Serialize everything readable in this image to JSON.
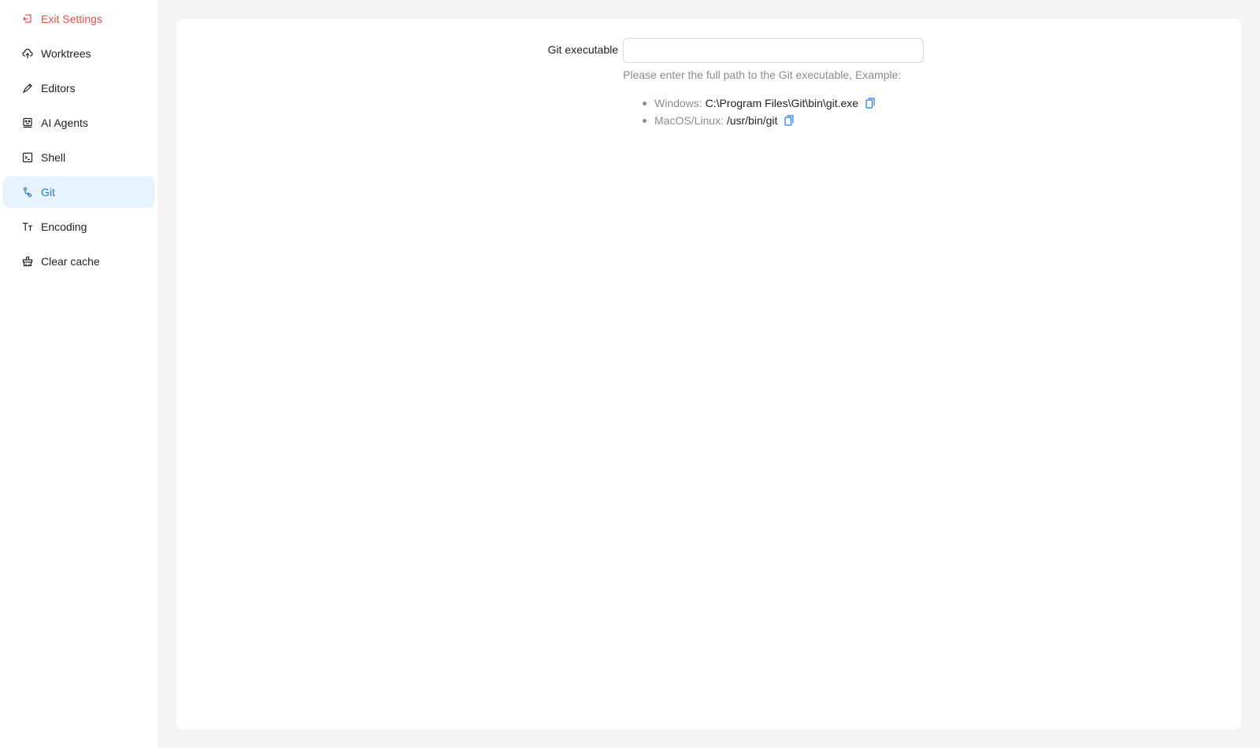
{
  "sidebar": {
    "items": [
      {
        "label": "Exit Settings",
        "icon": "exit-icon"
      },
      {
        "label": "Worktrees",
        "icon": "cloud-upload-icon"
      },
      {
        "label": "Editors",
        "icon": "edit-icon"
      },
      {
        "label": "AI Agents",
        "icon": "robot-icon"
      },
      {
        "label": "Shell",
        "icon": "terminal-icon"
      },
      {
        "label": "Git",
        "icon": "git-branch-icon",
        "active": true
      },
      {
        "label": "Encoding",
        "icon": "font-size-icon"
      },
      {
        "label": "Clear cache",
        "icon": "clear-icon"
      }
    ]
  },
  "git_settings": {
    "label": "Git executable",
    "value": "",
    "help": "Please enter the full path to the Git executable, Example:",
    "examples": [
      {
        "os": "Windows:",
        "path": "C:\\Program Files\\Git\\bin\\git.exe",
        "icon": "copy-icon"
      },
      {
        "os": "MacOS/Linux:",
        "path": "/usr/bin/git",
        "icon": "copy-icon"
      }
    ]
  },
  "colors": {
    "exit": "#e5534b",
    "active_bg": "#e6f4ff",
    "active_text": "#2f78c4",
    "copy_icon": "#1677ff"
  }
}
